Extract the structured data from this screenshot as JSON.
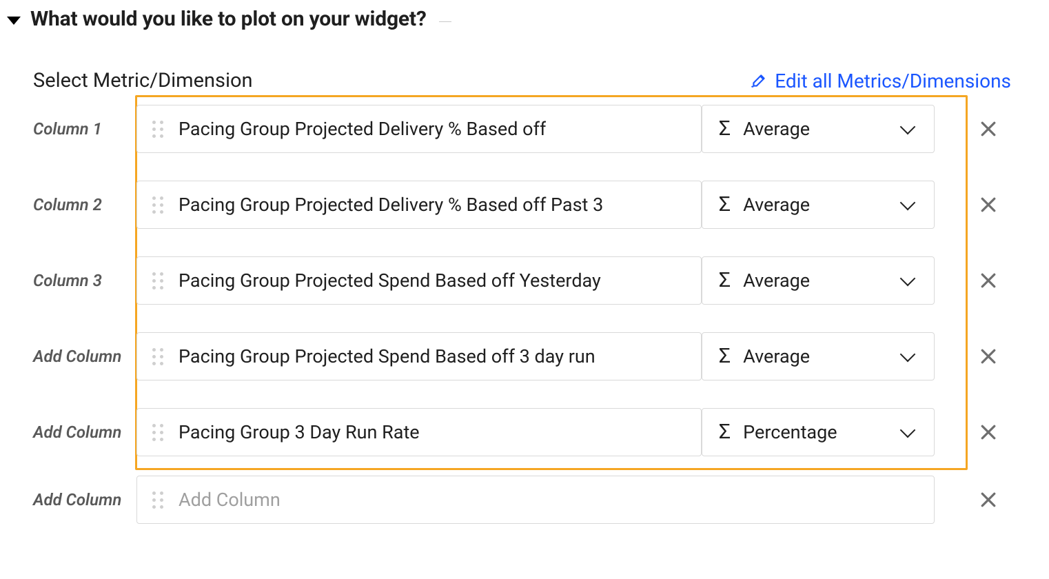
{
  "section": {
    "title": "What would you like to plot on your widget?"
  },
  "subheader": {
    "left": "Select Metric/Dimension",
    "edit_link": "Edit all Metrics/Dimensions"
  },
  "rows": [
    {
      "label": "Column 1",
      "metric": "Pacing Group Projected Delivery % Based off",
      "aggregation": "Average",
      "has_agg": true,
      "highlighted": true
    },
    {
      "label": "Column 2",
      "metric": "Pacing Group Projected Delivery % Based off Past 3",
      "aggregation": "Average",
      "has_agg": true,
      "highlighted": true
    },
    {
      "label": "Column 3",
      "metric": "Pacing Group Projected Spend Based off Yesterday",
      "aggregation": "Average",
      "has_agg": true,
      "highlighted": true
    },
    {
      "label": "Add Column",
      "metric": "Pacing Group Projected Spend Based off 3 day run",
      "aggregation": "Average",
      "has_agg": true,
      "highlighted": true
    },
    {
      "label": "Add Column",
      "metric": "Pacing Group 3 Day Run Rate",
      "aggregation": "Percentage",
      "has_agg": true,
      "highlighted": true
    },
    {
      "label": "Add Column",
      "metric": "",
      "aggregation": "",
      "has_agg": false,
      "highlighted": false,
      "placeholder": "Add Column"
    }
  ],
  "icons": {
    "sigma": "Σ"
  }
}
